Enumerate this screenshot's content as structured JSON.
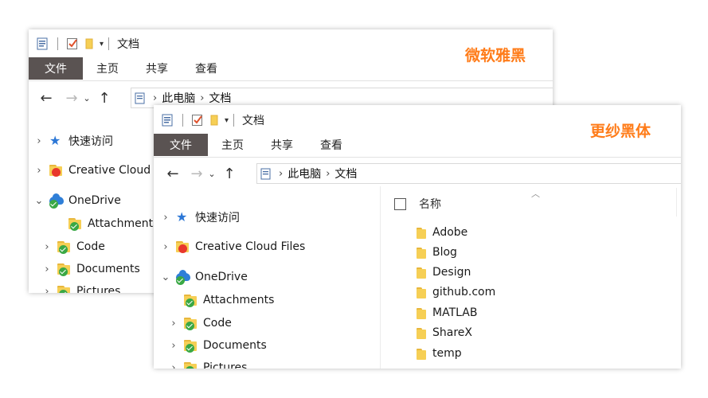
{
  "labels": {
    "back_font": "微软雅黑",
    "front_font": "更纱黑体"
  },
  "colors": {
    "label": "#ff7c19",
    "file_tab": "#5a5352",
    "folder": "#f6cf55",
    "sync_check": "#3aa845",
    "onedrive": "#2f7fd8"
  },
  "back_window": {
    "title": "文档",
    "ribbon_tabs": [
      "文件",
      "主页",
      "共享",
      "查看"
    ],
    "address": [
      "此电脑",
      "文档"
    ],
    "nav_items": [
      {
        "label": "快速访问",
        "icon": "star-icon"
      },
      {
        "label": "Creative Cloud",
        "icon": "creative-cloud-folder-icon"
      },
      {
        "label": "OneDrive",
        "icon": "onedrive-icon"
      },
      {
        "label": "Attachments",
        "icon": "synced-folder-icon"
      },
      {
        "label": "Code",
        "icon": "synced-folder-icon"
      },
      {
        "label": "Documents",
        "icon": "synced-folder-icon"
      },
      {
        "label": "Pictures",
        "icon": "synced-folder-icon"
      }
    ]
  },
  "front_window": {
    "title": "文档",
    "ribbon_tabs": [
      "文件",
      "主页",
      "共享",
      "查看"
    ],
    "address": [
      "此电脑",
      "文档"
    ],
    "nav_items": [
      {
        "label": "快速访问",
        "icon": "star-icon"
      },
      {
        "label": "Creative Cloud Files",
        "icon": "creative-cloud-folder-icon"
      },
      {
        "label": "OneDrive",
        "icon": "onedrive-icon"
      },
      {
        "label": "Attachments",
        "icon": "synced-folder-icon"
      },
      {
        "label": "Code",
        "icon": "synced-folder-icon"
      },
      {
        "label": "Documents",
        "icon": "synced-folder-icon"
      },
      {
        "label": "Pictures",
        "icon": "synced-folder-icon"
      }
    ],
    "list_header": "名称",
    "files": [
      "Adobe",
      "Blog",
      "Design",
      "github.com",
      "MATLAB",
      "ShareX",
      "temp"
    ]
  }
}
